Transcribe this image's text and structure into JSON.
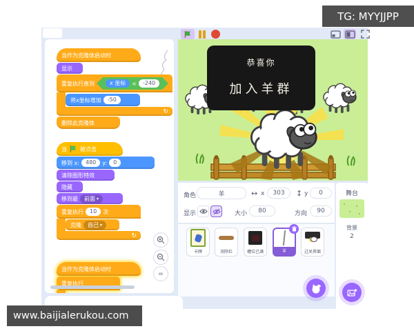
{
  "badge": {
    "text": "TG: MYYJJPP"
  },
  "watermark": {
    "text": "www.baijialerukou.com"
  },
  "icons": {
    "dropdown": "▾",
    "repeat_arrow": "↻",
    "x_axis": "↔",
    "y_axis": "↕",
    "less_than": "<",
    "zoom_reset": "="
  },
  "scripts": {
    "s1": {
      "hat": "当作为克隆体启动时",
      "show": "显示",
      "repeat_until": "重复执行直到",
      "x_reporter": "x 坐标",
      "limit": "-240",
      "change_x": "将x坐标增加",
      "delta": "-50",
      "delete_clone": "删除此克隆体"
    },
    "s2": {
      "when": "当",
      "clicked": "被点击",
      "goto_x_label": "移到 x:",
      "goto_x": "480",
      "goto_y_label": "y:",
      "goto_y": "0",
      "clear_fx": "清除图形特效",
      "hide": "隐藏",
      "go_layer": "移到最",
      "front": "前面",
      "repeat": "重复执行",
      "times_n": "10",
      "times": "次",
      "clone": "克隆",
      "myself": "自己"
    },
    "s3": {
      "hat": "当作为克隆体启动时",
      "forever": "重复执行"
    }
  },
  "stage": {
    "banner_line1": "恭喜你",
    "banner_line2": "加入羊群"
  },
  "sprite_panel": {
    "sprite_label": "角色",
    "name": "羊",
    "x_label": "x",
    "x": "303",
    "y_label": "y",
    "y": "0",
    "show_label": "显示",
    "size_label": "大小",
    "size": "80",
    "dir_label": "方向",
    "direction": "90"
  },
  "sprites": [
    {
      "name": "卡牌"
    },
    {
      "name": "消除栏"
    },
    {
      "name": "槽位已满"
    },
    {
      "name": "羊"
    },
    {
      "name": "过关界面"
    }
  ],
  "stage_pane": {
    "title": "舞台",
    "backdrops_label": "背景",
    "count": "2"
  }
}
